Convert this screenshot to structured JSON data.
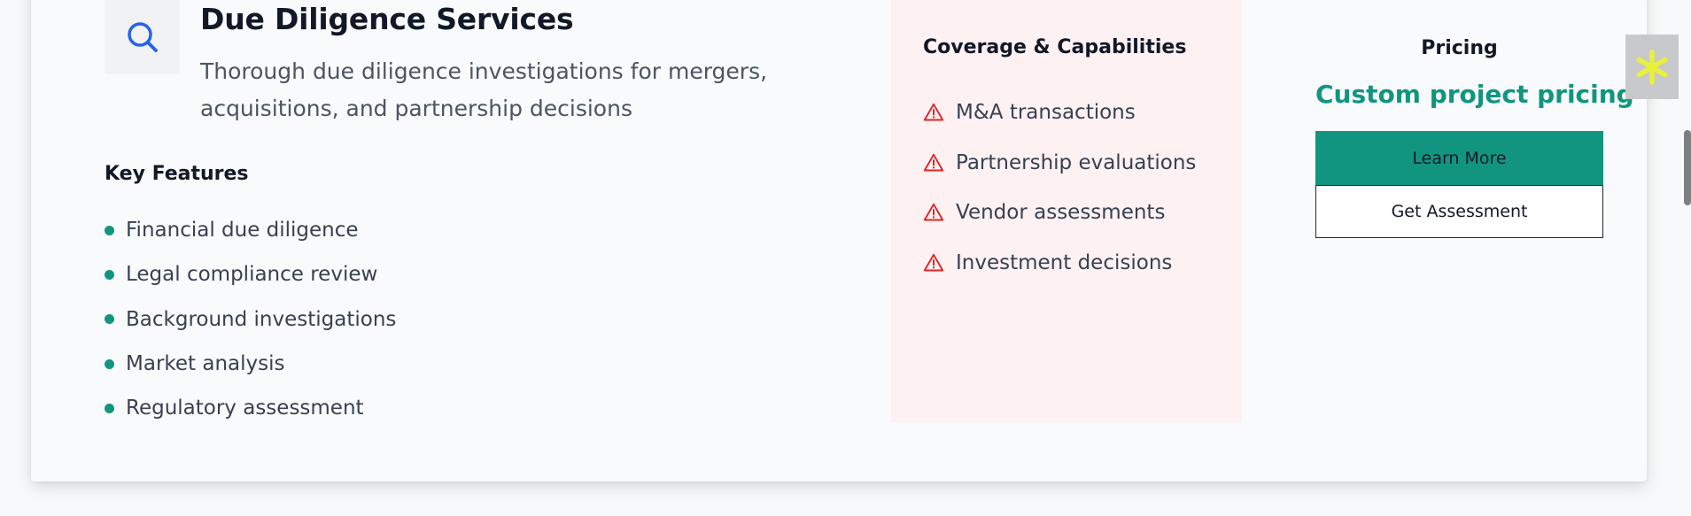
{
  "service": {
    "title": "Due Diligence Services",
    "subtitle": "Thorough due diligence investigations for mergers, acquisitions, and partnership decisions",
    "icon": "search-icon"
  },
  "features": {
    "heading": "Key Features",
    "items": [
      "Financial due diligence",
      "Legal compliance review",
      "Background investigations",
      "Market analysis",
      "Regulatory assessment"
    ]
  },
  "coverage": {
    "heading": "Coverage & Capabilities",
    "icon": "warning-icon",
    "items": [
      "M&A transactions",
      "Partnership evaluations",
      "Vendor assessments",
      "Investment decisions"
    ]
  },
  "pricing": {
    "label": "Pricing",
    "value": "Custom project pricing",
    "learn_more": "Learn More",
    "get_assessment": "Get Assessment"
  },
  "colors": {
    "accent": "#119580",
    "warning": "#dc2626",
    "coverage_bg": "#fdf1f2",
    "search_icon": "#2563eb",
    "widget_glyph": "#e8f23a"
  }
}
